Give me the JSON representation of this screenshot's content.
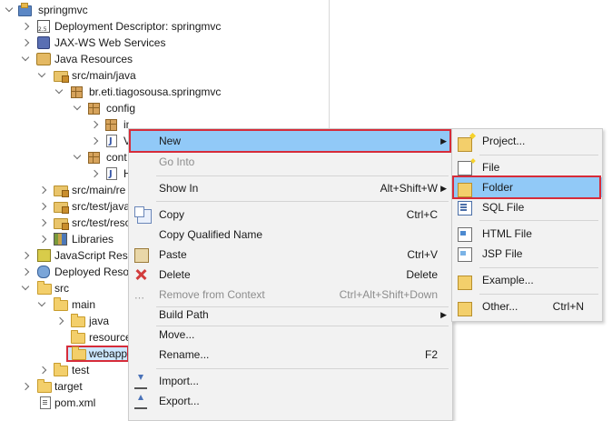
{
  "tree": [
    {
      "label": "springmvc",
      "icon": "project-icon",
      "twisty": "open",
      "indent": 0,
      "selected": false
    },
    {
      "label": "Deployment Descriptor: springmvc",
      "icon": "deployment-descriptor-icon",
      "twisty": "closed",
      "indent": 1
    },
    {
      "label": "JAX-WS Web Services",
      "icon": "web-services-icon",
      "twisty": "closed",
      "indent": 1
    },
    {
      "label": "Java Resources",
      "icon": "java-resources-icon",
      "twisty": "open",
      "indent": 1
    },
    {
      "label": "src/main/java",
      "icon": "source-folder-icon",
      "twisty": "open",
      "indent": 2
    },
    {
      "label": "br.eti.tiagosousa.springmvc",
      "icon": "package-icon",
      "twisty": "open",
      "indent": 3
    },
    {
      "label": "config",
      "icon": "package-icon",
      "twisty": "open",
      "indent": 4
    },
    {
      "label": "init",
      "icon": "package-icon",
      "twisty": "closed",
      "indent": 5
    },
    {
      "label": "V",
      "icon": "java-file-icon",
      "twisty": "closed",
      "indent": 5
    },
    {
      "label": "cont",
      "icon": "package-icon",
      "twisty": "open",
      "indent": 4
    },
    {
      "label": "H",
      "icon": "java-file-icon",
      "twisty": "closed",
      "indent": 5
    },
    {
      "label": "src/main/re",
      "icon": "source-folder-icon",
      "twisty": "closed",
      "indent": 2
    },
    {
      "label": "src/test/java",
      "icon": "source-folder-icon",
      "twisty": "closed",
      "indent": 2
    },
    {
      "label": "src/test/reso",
      "icon": "source-folder-icon",
      "twisty": "closed",
      "indent": 2
    },
    {
      "label": "Libraries",
      "icon": "libraries-icon",
      "twisty": "closed",
      "indent": 2
    },
    {
      "label": "JavaScript Reso",
      "icon": "javascript-resources-icon",
      "twisty": "closed",
      "indent": 1
    },
    {
      "label": "Deployed Reso",
      "icon": "deployed-resources-icon",
      "twisty": "closed",
      "indent": 1
    },
    {
      "label": "src",
      "icon": "folder-icon",
      "twisty": "open",
      "indent": 1
    },
    {
      "label": "main",
      "icon": "folder-icon",
      "twisty": "open",
      "indent": 2
    },
    {
      "label": "java",
      "icon": "folder-icon",
      "twisty": "closed",
      "indent": 3
    },
    {
      "label": "resource",
      "icon": "folder-icon",
      "twisty": "none",
      "indent": 3
    },
    {
      "label": "webapp",
      "icon": "folder-icon",
      "twisty": "none",
      "indent": 3,
      "selected": true
    },
    {
      "label": "test",
      "icon": "folder-icon",
      "twisty": "closed",
      "indent": 2
    },
    {
      "label": "target",
      "icon": "folder-icon",
      "twisty": "closed",
      "indent": 1
    },
    {
      "label": "pom.xml",
      "icon": "xml-file-icon",
      "twisty": "none",
      "indent": 1
    }
  ],
  "context_menu": {
    "items": [
      {
        "label": "New",
        "shortcut": "",
        "submenu": true,
        "enabled": true,
        "highlighted": true,
        "icon": ""
      },
      {
        "label": "Go Into",
        "shortcut": "",
        "submenu": false,
        "enabled": false,
        "icon": ""
      },
      {
        "label": "Show In",
        "shortcut": "Alt+Shift+W",
        "submenu": true,
        "enabled": true,
        "icon": ""
      },
      {
        "label": "Copy",
        "shortcut": "Ctrl+C",
        "submenu": false,
        "enabled": true,
        "icon": "copy-icon"
      },
      {
        "label": "Copy Qualified Name",
        "shortcut": "",
        "submenu": false,
        "enabled": true,
        "icon": ""
      },
      {
        "label": "Paste",
        "shortcut": "Ctrl+V",
        "submenu": false,
        "enabled": true,
        "icon": "paste-icon"
      },
      {
        "label": "Delete",
        "shortcut": "Delete",
        "submenu": false,
        "enabled": true,
        "icon": "delete-icon"
      },
      {
        "label": "Remove from Context",
        "shortcut": "Ctrl+Alt+Shift+Down",
        "submenu": false,
        "enabled": false,
        "icon": "remove-context-icon"
      },
      {
        "label": "Build Path",
        "shortcut": "",
        "submenu": true,
        "enabled": true,
        "icon": ""
      },
      {
        "label": "Move...",
        "shortcut": "",
        "submenu": false,
        "enabled": true,
        "icon": ""
      },
      {
        "label": "Rename...",
        "shortcut": "F2",
        "submenu": false,
        "enabled": true,
        "icon": ""
      },
      {
        "label": "Import...",
        "shortcut": "",
        "submenu": false,
        "enabled": true,
        "icon": "import-icon"
      },
      {
        "label": "Export...",
        "shortcut": "",
        "submenu": false,
        "enabled": true,
        "icon": "export-icon"
      }
    ]
  },
  "submenu_new": {
    "items": [
      {
        "label": "Project...",
        "shortcut": "",
        "icon": "new-project-icon"
      },
      {
        "label": "File",
        "shortcut": "",
        "icon": "new-file-icon"
      },
      {
        "label": "Folder",
        "shortcut": "",
        "icon": "new-folder-icon",
        "highlighted": true
      },
      {
        "label": "SQL File",
        "shortcut": "",
        "icon": "sql-file-icon"
      },
      {
        "label": "HTML File",
        "shortcut": "",
        "icon": "html-file-icon"
      },
      {
        "label": "JSP File",
        "shortcut": "",
        "icon": "jsp-file-icon"
      },
      {
        "label": "Example...",
        "shortcut": "",
        "icon": "example-icon"
      },
      {
        "label": "Other...",
        "shortcut": "Ctrl+N",
        "icon": "other-icon"
      }
    ]
  },
  "colors": {
    "highlight": "#91c9f7",
    "callout_red": "#d62c3a",
    "menu_bg": "#f2f2f2"
  }
}
